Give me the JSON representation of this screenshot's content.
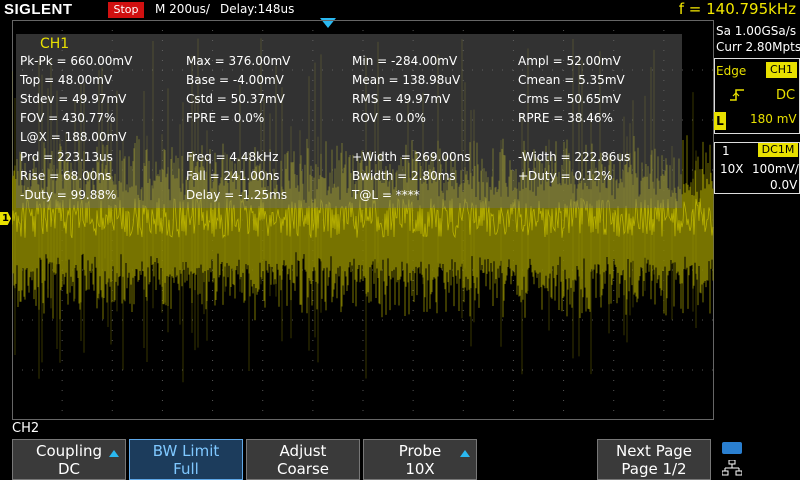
{
  "header": {
    "logo": "SIGLENT",
    "run_state": "Stop",
    "timebase": "M 200us/",
    "delay": "Delay:148us",
    "frequency": "f = 140.795kHz"
  },
  "measurements": {
    "channel": "CH1",
    "rows": [
      [
        "Pk-Pk = 660.00mV",
        "Max = 376.00mV",
        "Min = -284.00mV",
        "Ampl = 52.00mV"
      ],
      [
        "Top = 48.00mV",
        "Base = -4.00mV",
        "Mean = 138.98uV",
        "Cmean = 5.35mV"
      ],
      [
        "Stdev = 49.97mV",
        "Cstd = 50.37mV",
        "RMS = 49.97mV",
        "Crms = 50.65mV"
      ],
      [
        "FOV = 430.77%",
        "FPRE = 0.0%",
        "ROV = 0.0%",
        "RPRE = 38.46%"
      ],
      [
        "L@X = 188.00mV",
        "",
        "",
        ""
      ],
      [
        "Prd = 223.13us",
        "Freq = 4.48kHz",
        "+Width = 269.00ns",
        "-Width = 222.86us"
      ],
      [
        "Rise = 68.00ns",
        "Fall = 241.00ns",
        "Bwidth = 2.80ms",
        "+Duty = 0.12%"
      ],
      [
        "-Duty = 99.88%",
        "Delay = -1.25ms",
        "T@L = ****",
        ""
      ]
    ]
  },
  "right_panel": {
    "sample_rate": "Sa 1.00GSa/s",
    "memory": "Curr 2.80Mpts",
    "trigger_type": "Edge",
    "trigger_source": "CH1",
    "trigger_coupling": "DC",
    "level_badge": "L",
    "trigger_level": "180 mV",
    "channel_number": "1",
    "channel_coupling": "DC1M",
    "probe": "10X",
    "scale": "100mV/",
    "offset": "0.0V"
  },
  "ch1_marker": "1",
  "menu": {
    "title": "CH2",
    "buttons": [
      {
        "line1": "Coupling",
        "line2": "DC"
      },
      {
        "line1": "BW Limit",
        "line2": "Full"
      },
      {
        "line1": "Adjust",
        "line2": "Coarse"
      },
      {
        "line1": "Probe",
        "line2": "10X"
      },
      {
        "line1": "Next Page",
        "line2": "Page 1/2"
      }
    ]
  },
  "colors": {
    "ch1": "#e8e000",
    "accent": "#2ab8f0",
    "stop": "#d01010"
  }
}
